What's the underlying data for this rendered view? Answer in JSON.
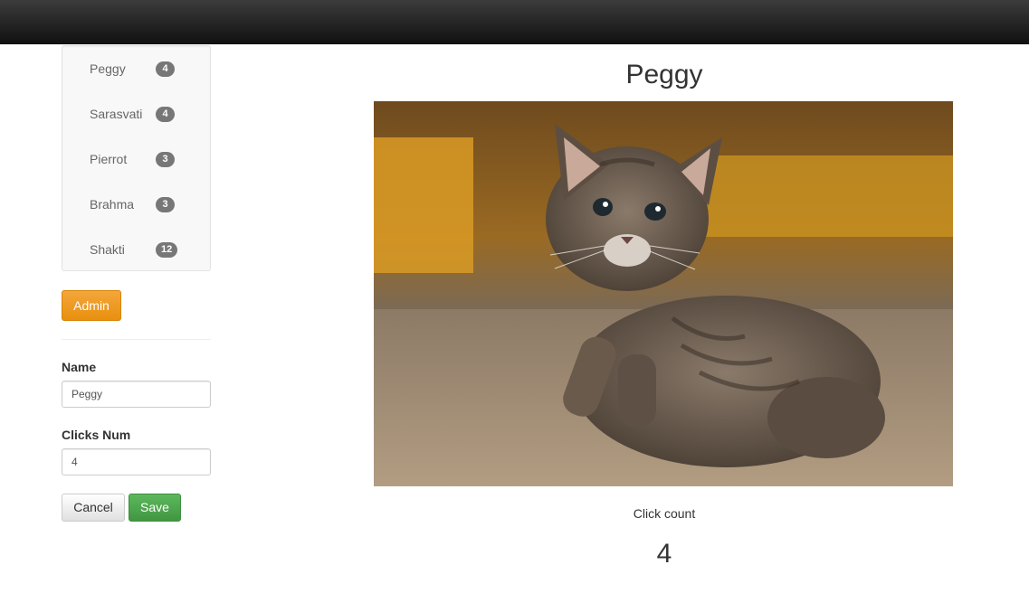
{
  "cats": [
    {
      "name": "Peggy",
      "clicks": "4"
    },
    {
      "name": "Sarasvati",
      "clicks": "4"
    },
    {
      "name": "Pierrot",
      "clicks": "3"
    },
    {
      "name": "Brahma",
      "clicks": "3"
    },
    {
      "name": "Shakti",
      "clicks": "12"
    }
  ],
  "admin": {
    "button_label": "Admin",
    "name_label": "Name",
    "name_value": "Peggy",
    "clicks_label": "Clicks Num",
    "clicks_value": "4",
    "cancel_label": "Cancel",
    "save_label": "Save"
  },
  "current": {
    "name": "Peggy",
    "photo_icon": "kitten-photo",
    "click_label": "Click count",
    "click_value": "4"
  },
  "colors": {
    "topbar": "#222222",
    "admin_button": "#f0a030",
    "save_button": "#4cae4c",
    "badge": "#777777"
  }
}
